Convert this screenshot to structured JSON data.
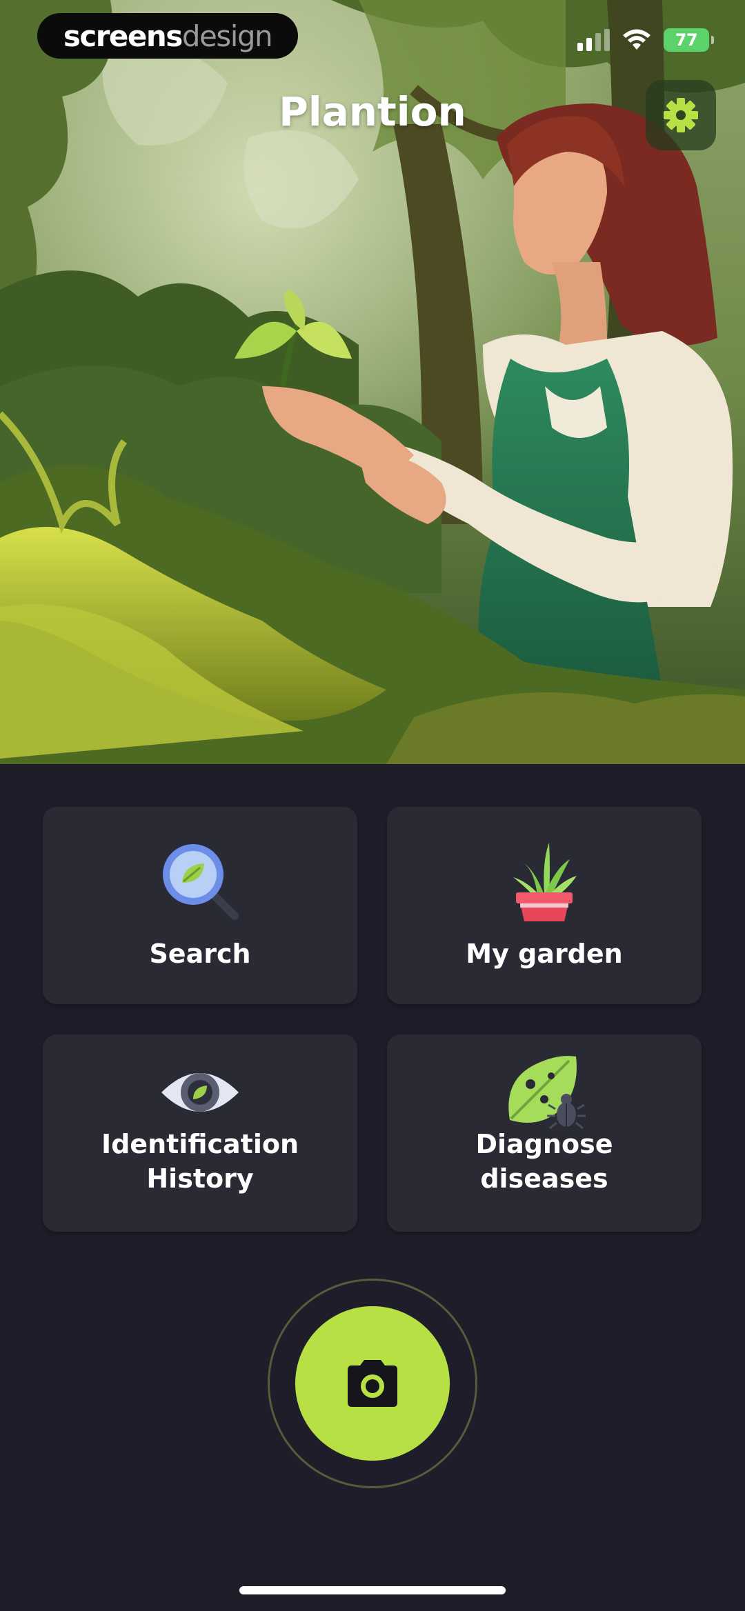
{
  "watermark": {
    "part1": "screens",
    "part2": "design"
  },
  "status_bar": {
    "battery_level": "77",
    "icons": [
      "signal-icon",
      "wifi-icon",
      "battery-icon"
    ]
  },
  "header": {
    "title": "Plantion",
    "settings_icon": "gear-icon"
  },
  "tiles": [
    {
      "label_lines": [
        "Search"
      ],
      "icon": "magnifier-leaf-icon"
    },
    {
      "label_lines": [
        "My garden"
      ],
      "icon": "potted-plant-icon"
    },
    {
      "label_lines": [
        "Identification",
        "History"
      ],
      "icon": "eye-leaf-icon"
    },
    {
      "label_lines": [
        "Diagnose",
        "diseases"
      ],
      "icon": "leaf-bug-icon"
    }
  ],
  "camera_button": {
    "icon": "camera-icon"
  },
  "colors": {
    "background": "#1e1d29",
    "tile": "#2a2a35",
    "accent": "#b6e043",
    "title": "#ffffff"
  }
}
